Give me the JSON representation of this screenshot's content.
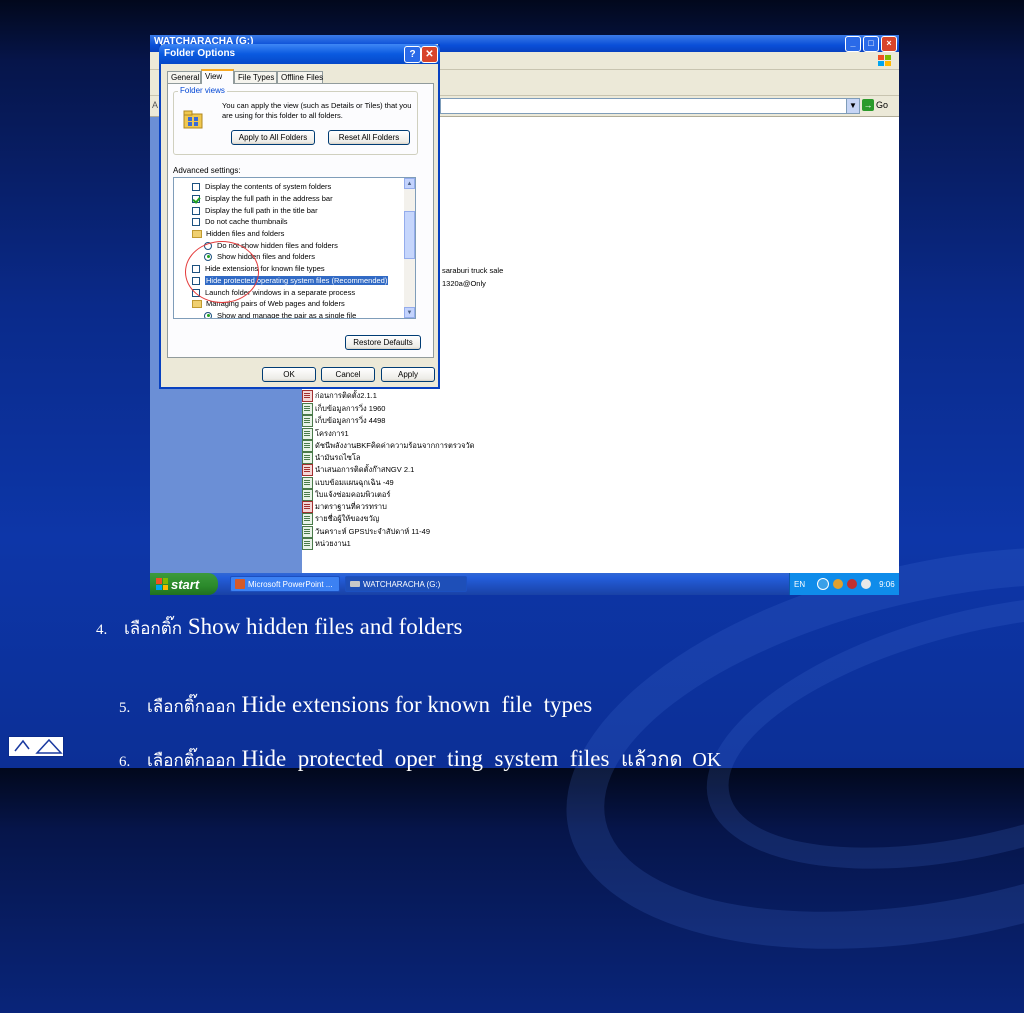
{
  "explorer": {
    "title": "WATCHARACHA (G:)",
    "address_label": "A",
    "go_label": "Go",
    "files": [
      {
        "name": "saraburi truck sale",
        "type": "doc"
      },
      {
        "name": "1320a@Only",
        "type": "doc"
      },
      {
        "name": "ก่อนการติดตั้ง2.1.1",
        "type": "pdf"
      },
      {
        "name": "เก็บข้อมูลการวิ่ง 1960",
        "type": "doc"
      },
      {
        "name": "เก็บข้อมูลการวิ่ง 4498",
        "type": "doc"
      },
      {
        "name": "โครงการ1",
        "type": "doc"
      },
      {
        "name": "ดัชนีพลังงานBKFคิดค่าความร้อนจากการตรวจวัด",
        "type": "doc"
      },
      {
        "name": "นำมันรถไซโล",
        "type": "doc"
      },
      {
        "name": "นำเสนอการติดตั้งก๊าสNGV 2.1",
        "type": "pdf"
      },
      {
        "name": "แบบข้อมแผนฉุกเฉิน -49",
        "type": "doc"
      },
      {
        "name": "ใบแจ้งซ่อมคอมพิวเตอร์",
        "type": "doc"
      },
      {
        "name": "มาตราฐานที่ควรทราบ",
        "type": "pdf"
      },
      {
        "name": "รายชื่อผู้ให้ของขวัญ",
        "type": "doc"
      },
      {
        "name": "วันคราะห์ GPSประจำสัปดาห์ 11-49",
        "type": "doc"
      },
      {
        "name": "หน่วยงาน1",
        "type": "doc"
      }
    ]
  },
  "dialog": {
    "title": "Folder Options",
    "help_glyph": "?",
    "close_glyph": "✕",
    "tabs": [
      "General",
      "View",
      "File Types",
      "Offline Files"
    ],
    "selected_tab": "View",
    "folder_views": {
      "label": "Folder views",
      "description": "You can apply the view (such as Details or Tiles) that you are using for this folder to all folders.",
      "apply_button": "Apply to All Folders",
      "reset_button": "Reset All Folders"
    },
    "advanced_label": "Advanced settings:",
    "advanced_items": [
      {
        "kind": "checkbox",
        "checked": false,
        "label": "Display the contents of system folders"
      },
      {
        "kind": "checkbox",
        "checked": true,
        "label": "Display the full path in the address bar"
      },
      {
        "kind": "checkbox",
        "checked": false,
        "label": "Display the full path in the title bar"
      },
      {
        "kind": "checkbox",
        "checked": false,
        "label": "Do not cache thumbnails"
      },
      {
        "kind": "folder",
        "label": "Hidden files and folders"
      },
      {
        "kind": "radio",
        "checked": false,
        "label": "Do not show hidden files and folders"
      },
      {
        "kind": "radio",
        "checked": true,
        "label": "Show hidden files and folders"
      },
      {
        "kind": "checkbox",
        "checked": false,
        "label": "Hide extensions for known file types"
      },
      {
        "kind": "checkbox",
        "checked": false,
        "selected": true,
        "label": "Hide protected operating system files (Recommended)"
      },
      {
        "kind": "checkbox",
        "checked": false,
        "label": "Launch folder windows in a separate process"
      },
      {
        "kind": "folder",
        "label": "Managing pairs of Web pages and folders"
      },
      {
        "kind": "radio",
        "checked": true,
        "label": "Show and manage the pair as a single file"
      }
    ],
    "restore_button": "Restore Defaults",
    "ok_button": "OK",
    "cancel_button": "Cancel",
    "apply_button": "Apply"
  },
  "taskbar": {
    "start_label": "start",
    "tasks": [
      {
        "label": "Microsoft PowerPoint ...",
        "active": false
      },
      {
        "label": "WATCHARACHA (G:)",
        "active": true
      }
    ],
    "language": "EN",
    "clock": "9:06"
  },
  "slide": {
    "steps": [
      {
        "num": "4.",
        "thai": "เลือกติ๊ก",
        "text": "Show hidden files and folders"
      },
      {
        "num": "5.",
        "thai": "เลือกติ๊กออก",
        "text": "Hide extensions for known  file  types"
      },
      {
        "num": "6.",
        "thai": "เลือกติ๊กออก",
        "text": "Hide  protected  oper  ting  system  files",
        "suffix": "แล้วกด  OK"
      }
    ]
  },
  "colors": {
    "slide_bg": "#0a2a8a",
    "xp_blue": "#0a4fd8",
    "dialog_face": "#ece9d8",
    "selection": "#316ac5",
    "annotation": "#e43a3a"
  }
}
